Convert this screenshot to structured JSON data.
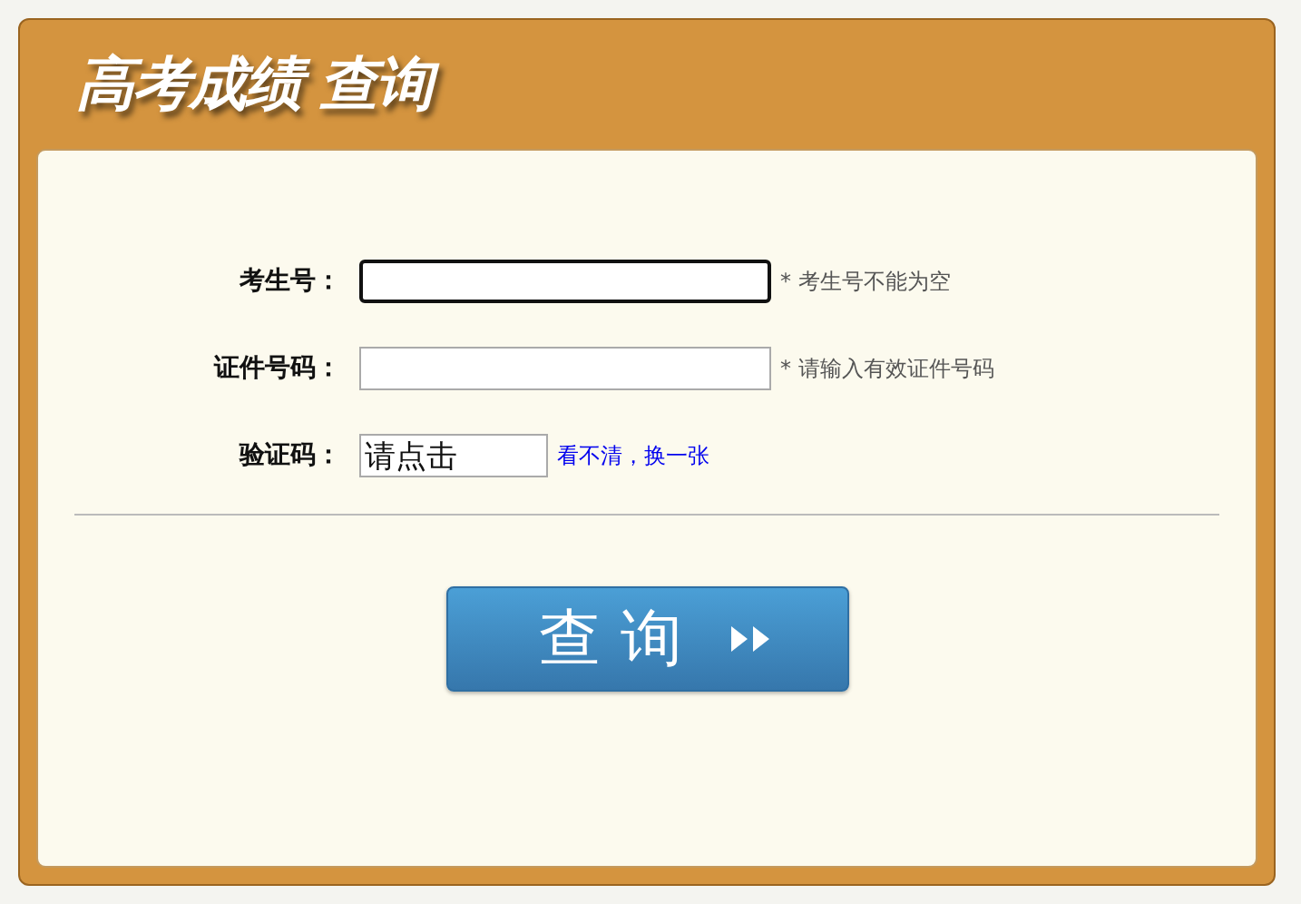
{
  "header": {
    "title": "高考成绩 查询"
  },
  "fields": [
    {
      "kind": "text",
      "label": "考生号：",
      "focused": true,
      "hint": "* 考生号不能为空"
    },
    {
      "kind": "text",
      "label": "证件号码：",
      "focused": false,
      "hint": "* 请输入有效证件号码"
    },
    {
      "kind": "captcha",
      "label": "验证码：",
      "focused": false,
      "value": "请点击",
      "link": "看不清，换一张"
    }
  ],
  "submit": {
    "label": "查 询"
  }
}
